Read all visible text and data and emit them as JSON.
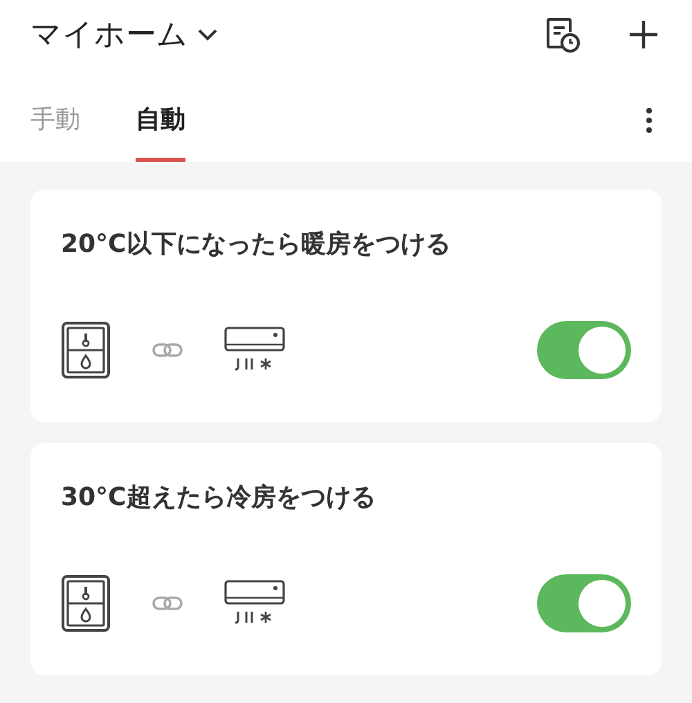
{
  "header": {
    "title": "マイホーム"
  },
  "tabs": [
    {
      "label": "手動",
      "selected": false
    },
    {
      "label": "自動",
      "selected": true
    }
  ],
  "automations": [
    {
      "title": "20°C以下になったら暖房をつける",
      "on": true
    },
    {
      "title": "30°C超えたら冷房をつける",
      "on": true
    }
  ]
}
